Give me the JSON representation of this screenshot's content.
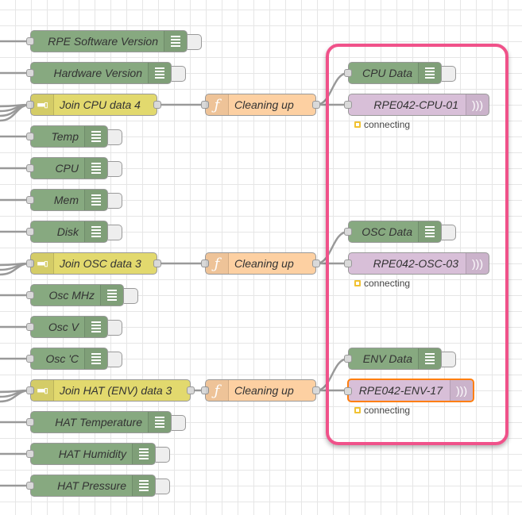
{
  "debug_nodes": {
    "rpe_software_version": "RPE Software Version",
    "hardware_version": "Hardware Version",
    "temp": "Temp",
    "cpu": "CPU",
    "mem": "Mem",
    "disk": "Disk",
    "osc_mhz": "Osc MHz",
    "osc_v": "Osc V",
    "osc_c": "Osc 'C",
    "hat_temperature": "HAT Temperature",
    "hat_humidity": "HAT Humidity",
    "hat_pressure": "HAT Pressure",
    "cpu_data": "CPU Data",
    "osc_data": "OSC Data",
    "env_data": "ENV Data"
  },
  "join_nodes": {
    "cpu": "Join CPU data 4",
    "osc": "Join OSC data 3",
    "hat": "Join HAT (ENV) data 3"
  },
  "function_nodes": {
    "cleaning_1": "Cleaning up",
    "cleaning_2": "Cleaning up",
    "cleaning_3": "Cleaning up"
  },
  "mqtt_nodes": {
    "cpu": "RPE042-CPU-01",
    "osc": "RPE042-OSC-03",
    "env": "RPE042-ENV-17"
  },
  "status": {
    "cpu": "connecting",
    "osc": "connecting",
    "env": "connecting"
  },
  "icons": {
    "debug": "list-icon",
    "function": "function-icon",
    "join": "join-icon",
    "mqtt": "wireless-icon"
  },
  "colors": {
    "debug_node": "#87a980",
    "join_node": "#e2d96e",
    "function_node": "#fdd0a2",
    "mqtt_node": "#d8bfd8",
    "group_border": "#f0528a",
    "selected_border": "#ff7f0e",
    "status_connecting": "#f1c232"
  }
}
